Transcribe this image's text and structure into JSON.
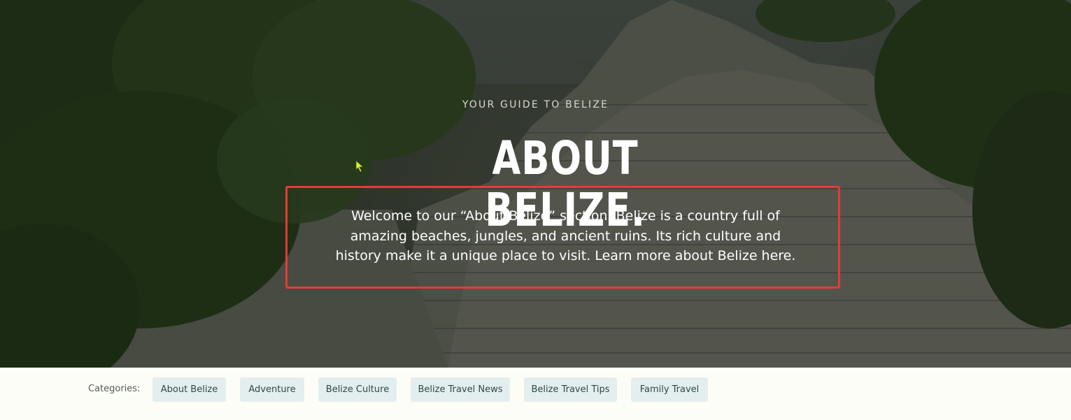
{
  "hero": {
    "eyebrow": "YOUR GUIDE TO BELIZE",
    "title": "ABOUT BELIZE.",
    "intro_line1": "Welcome to our “About Belize” section. Belize is a country full of",
    "intro_line2": "amazing beaches, jungles, and ancient ruins. Its rich culture and",
    "intro_line3": "history make it a unique place to visit. Learn more about Belize here.",
    "highlight_color": "#e23c3c"
  },
  "categories": {
    "label": "Categories:",
    "items": [
      "About Belize",
      "Adventure",
      "Belize Culture",
      "Belize Travel News",
      "Belize Travel Tips",
      "Family Travel"
    ]
  },
  "colors": {
    "chip_bg": "#e3efee",
    "chip_text": "#2d4a4a",
    "page_bg": "#fdfdf7"
  },
  "icons": {
    "cursor": "mouse-pointer-icon"
  }
}
